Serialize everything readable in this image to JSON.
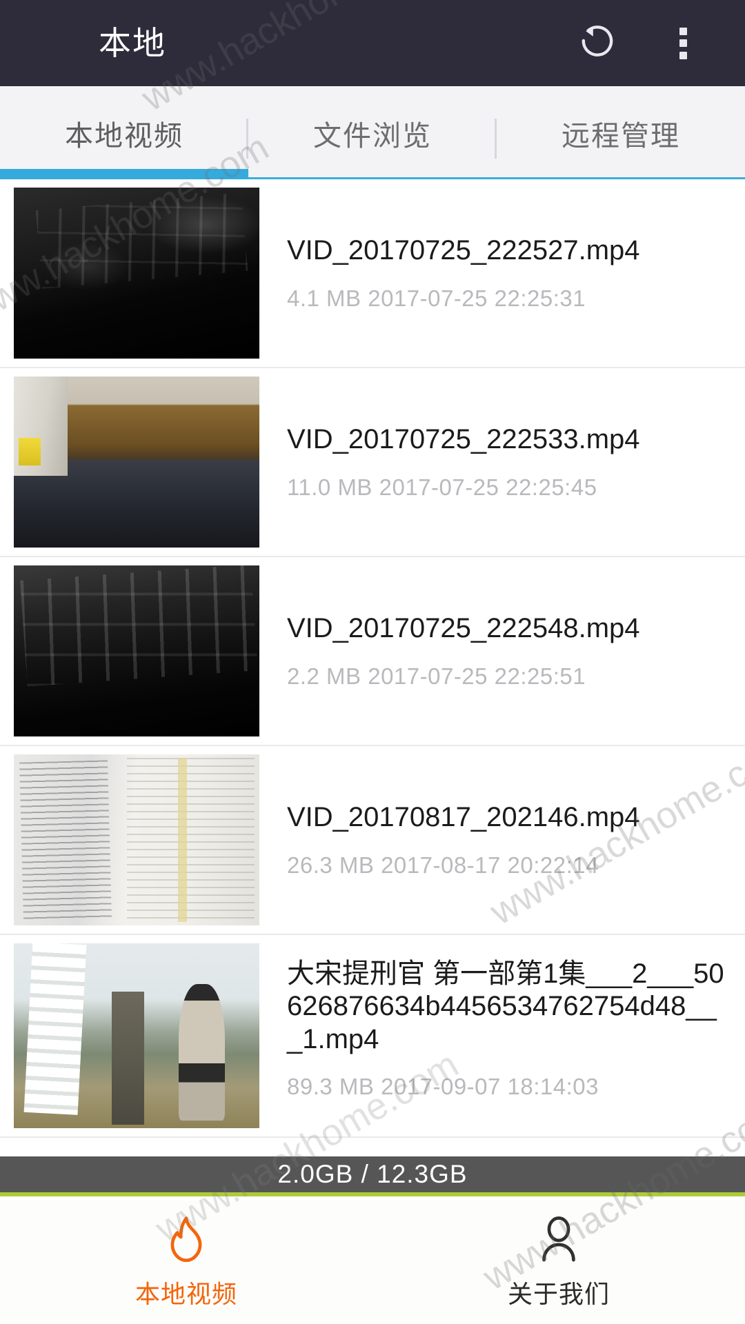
{
  "appbar": {
    "title": "本地",
    "refresh_icon": "refresh-ccw-icon",
    "more_icon": "overflow-menu-icon"
  },
  "tabs": [
    {
      "label": "本地视频",
      "active": true
    },
    {
      "label": "文件浏览",
      "active": false
    },
    {
      "label": "远程管理",
      "active": false
    }
  ],
  "videos": [
    {
      "name": "VID_20170725_222527.mp4",
      "size": "4.1 MB",
      "datetime": "2017-07-25 22:25:31",
      "info": "4.1 MB  2017-07-25 22:25:31",
      "thumb": "keyboard-dark"
    },
    {
      "name": "VID_20170725_222533.mp4",
      "size": "11.0 MB",
      "datetime": "2017-07-25 22:25:45",
      "info": "11.0 MB  2017-07-25 22:25:45",
      "thumb": "desk-scene"
    },
    {
      "name": "VID_20170725_222548.mp4",
      "size": "2.2 MB",
      "datetime": "2017-07-25 22:25:51",
      "info": "2.2 MB  2017-07-25 22:25:51",
      "thumb": "keyboard-closeup"
    },
    {
      "name": "VID_20170817_202146.mp4",
      "size": "26.3 MB",
      "datetime": "2017-08-17 20:22:14",
      "info": "26.3 MB  2017-08-17 20:22:14",
      "thumb": "document-screen"
    },
    {
      "name": "大宋提刑官 第一部第1集___2___50626876634b4456534762754d48___1.mp4",
      "size": "89.3 MB",
      "datetime": "2017-09-07 18:14:03",
      "info": "89.3 MB  2017-09-07 18:14:03",
      "thumb": "drama-scene"
    }
  ],
  "storage": {
    "used": "2.0GB",
    "total": "12.3GB",
    "text": "2.0GB / 12.3GB"
  },
  "bottom_nav": [
    {
      "label": "本地视频",
      "icon": "flame-icon",
      "active": true
    },
    {
      "label": "关于我们",
      "icon": "person-icon",
      "active": false
    }
  ],
  "watermark": {
    "text": "www.hackhome.com"
  },
  "colors": {
    "appbar": "#2e2c3b",
    "tab_accent": "#35aadc",
    "nav_accent": "#f4650b",
    "storage_bar": "#565656",
    "storage_underline": "#aecb3a"
  }
}
